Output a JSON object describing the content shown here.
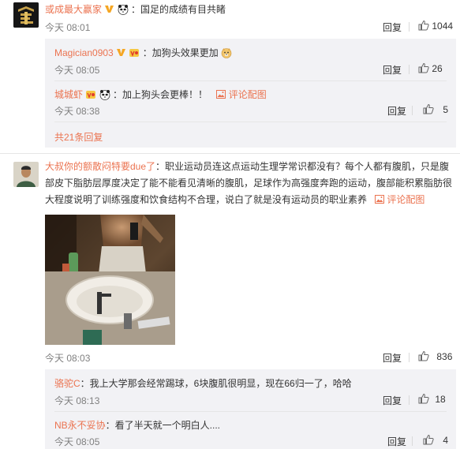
{
  "comments": [
    {
      "user": "或成最大赢家",
      "text": "：国足的成绩有目共睹",
      "time": "今天 08:01",
      "reply_label": "回复",
      "likes": "1044",
      "sub_replies": [
        {
          "user": "Magician0903",
          "text": "：加狗头效果更加",
          "time": "今天 08:05",
          "reply_label": "回复",
          "likes": "26"
        },
        {
          "user": "城城虾",
          "text": "：加上狗头会更棒！！",
          "pic_link": "评论配图",
          "time": "今天 08:38",
          "reply_label": "回复",
          "likes": "5"
        }
      ],
      "more_replies": "共21条回复"
    },
    {
      "user": "大叔你的额散闷特要due了",
      "text_lines": [
        "：职业运动员连这点运动生理学常识都没有？每个人都有腹肌，只是腹",
        "部皮下脂肪层厚度决定了能不能看见清晰的腹肌，足球作为高强度奔跑的运动，腹部能积累脂肪很",
        "大程度说明了训练强度和饮食结构不合理，说白了就是没有运动员的职业素养"
      ],
      "pic_link": "评论配图",
      "time": "今天 08:03",
      "reply_label": "回复",
      "likes": "836",
      "sub_replies": [
        {
          "user": "骆驼C",
          "text": "：我上大学那会经常踢球，6块腹肌很明显，现在66归一了，哈哈",
          "time": "今天 08:13",
          "reply_label": "回复",
          "likes": "18"
        },
        {
          "user": "NB永不妥协",
          "text": "：看了半天就一个明白人....",
          "time": "今天 08:05",
          "reply_label": "回复",
          "likes": "4"
        }
      ]
    }
  ],
  "colors": {
    "name": "#eb7350",
    "subbox_bg": "#f2f2f5",
    "time": "#808080"
  }
}
